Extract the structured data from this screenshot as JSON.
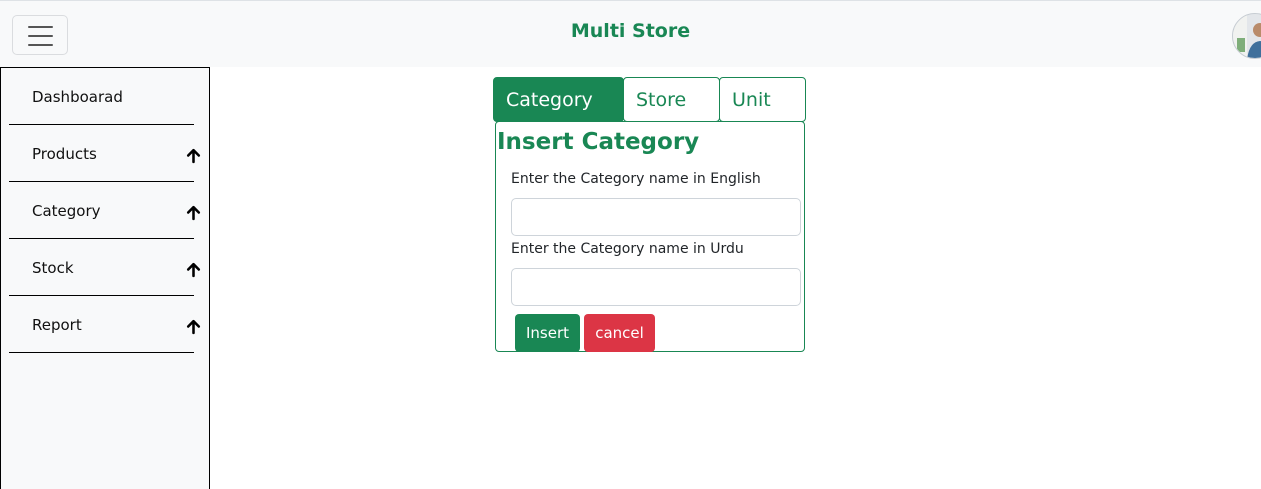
{
  "header": {
    "app_title": "Multi Store",
    "menu_icon": "hamburger-menu-icon",
    "avatar_icon": "user-avatar"
  },
  "sidebar": {
    "items": [
      {
        "label": "Dashboarad",
        "icon": null
      },
      {
        "label": "Products",
        "icon": "arrow-up-icon"
      },
      {
        "label": "Category",
        "icon": "arrow-up-icon"
      },
      {
        "label": "Stock",
        "icon": "arrow-up-icon"
      },
      {
        "label": "Report",
        "icon": "arrow-up-icon"
      }
    ]
  },
  "tabs": [
    {
      "label": "Category",
      "active": true
    },
    {
      "label": "Store",
      "active": false
    },
    {
      "label": "Unit",
      "active": false
    }
  ],
  "form": {
    "title": "Insert Category",
    "english_label": "Enter the Category name in English",
    "english_value": "",
    "urdu_label": "Enter the Category name in Urdu",
    "urdu_value": "",
    "insert_label": "Insert",
    "cancel_label": "cancel"
  },
  "colors": {
    "accent": "#198754",
    "danger": "#dc3545",
    "topbar_bg": "#f8f9fa"
  }
}
